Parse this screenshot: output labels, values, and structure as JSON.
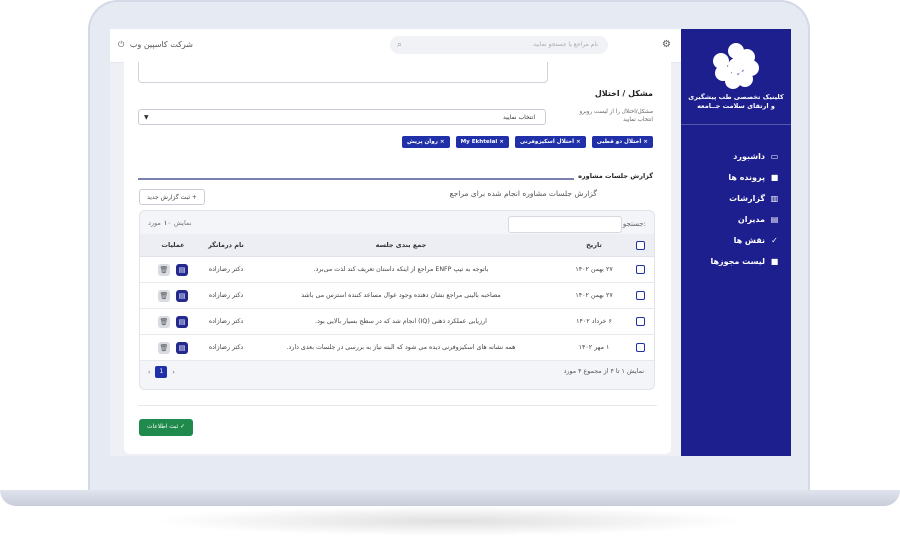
{
  "app": {
    "company_name": "شرکت کاسپین وب",
    "search_placeholder": "نام مراجع یا جستجو نمایید",
    "brand_line1": "کلینیک تخصصی طب پیشگیری",
    "brand_line2": "و ارتقای سلامت جــامعه"
  },
  "sidebar": {
    "items": [
      {
        "label": "داشبورد",
        "icon": "monitor-icon"
      },
      {
        "label": "پرونده ها",
        "icon": "briefcase-icon"
      },
      {
        "label": "گزارشات",
        "icon": "chart-icon"
      },
      {
        "label": "مدیران",
        "icon": "users-icon"
      },
      {
        "label": "نقش ها",
        "icon": "user-check-icon"
      },
      {
        "label": "لیست مجوزها",
        "icon": "lock-icon"
      }
    ]
  },
  "form": {
    "issue_title": "مشکل / اختلال",
    "issue_help": "مشکل/اختلال را از لیست روبرو انتخاب نمایید",
    "select_value": "انتخاب نمایید",
    "tags": [
      "اختلال دو قطبی",
      "اختلال اسکیزوفرنی",
      "My Ekhtelal",
      "روان پریش"
    ],
    "section_title": "گزارش جلسات مشاوره",
    "section_desc": "گزارش جلسات مشاوره انجام شده برای مراجع",
    "new_report_label": "ثبت گزارش جدید",
    "submit_label": "ثبت اطلاعات"
  },
  "table": {
    "search_label": "جستجو:",
    "show_label": "نمایش",
    "show_value": "۱۰",
    "show_suffix": "مورد",
    "headers": {
      "date": "تاریخ",
      "summary": "جمع بندی جلسه",
      "doctor": "نام درمانگر",
      "ops": "عملیات"
    },
    "rows": [
      {
        "date": "۲۷ بهمن ۱۴۰۲",
        "summary": "باتوجه به تیپ ENFP مراجع از اینکه داستان تعریف کند لذت می‌برد.",
        "doctor": "دکتر رضازاده"
      },
      {
        "date": "۲۷ بهمن ۱۴۰۲",
        "summary": "مصاحبه بالینی مراجع نشان دهنده وجود عوال مساعد کننده استرس می باشد",
        "doctor": "دکتر رضازاده"
      },
      {
        "date": "۶ خرداد ۱۴۰۲",
        "summary": "ارزیابی عملکرد ذهنی (IQ) انجام شد که در سطح بسیار بالایی بود.",
        "doctor": "دکتر رضازاده"
      },
      {
        "date": "۱ مهر ۱۴۰۲",
        "summary": "همه نشانه های اسکیزوفرنی دیده می شود که البته نیاز به بررسی در جلسات بعدی دارد.",
        "doctor": "دکتر رضازاده"
      }
    ],
    "footer_text": "نمایش ۱ تا ۴ از مجموع ۴ مورد",
    "current_page": "1"
  }
}
